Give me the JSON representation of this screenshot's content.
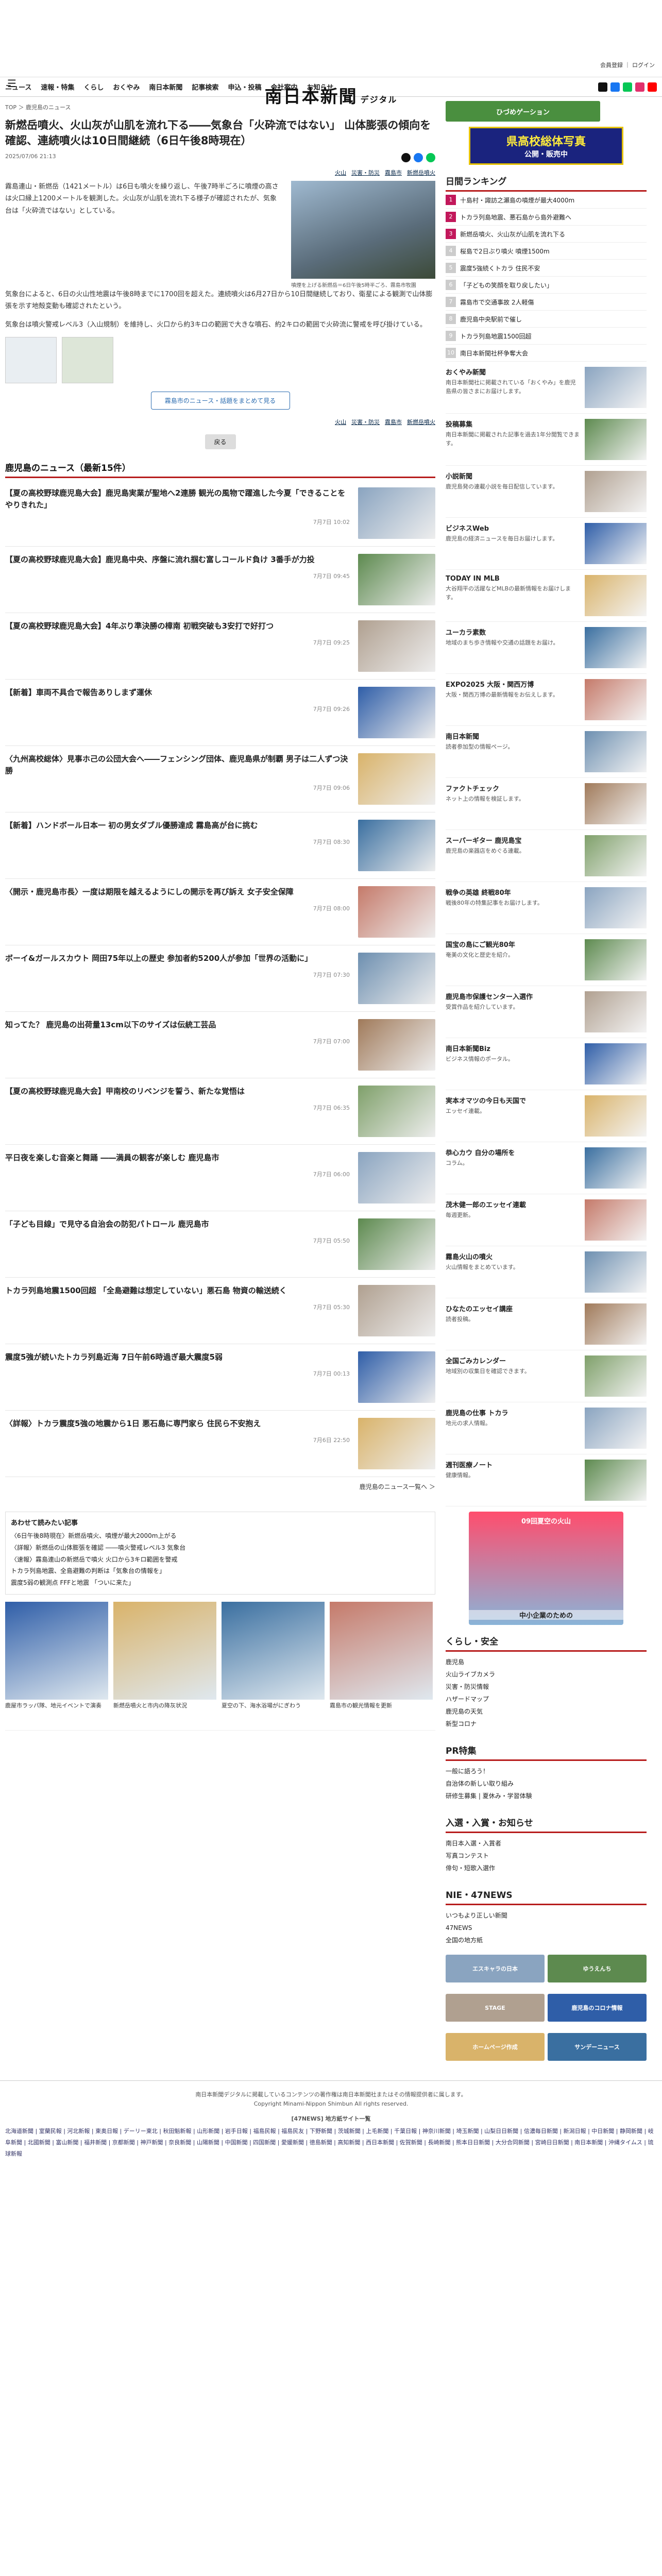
{
  "header": {
    "brand": "南日本新聞",
    "brand_sub": "デジタル",
    "top_right": "会員登録",
    "login": "ログイン"
  },
  "nav": [
    "ニュース",
    "速報・特集",
    "くらし",
    "おくやみ",
    "南日本新聞",
    "記事検索",
    "申込・投稿",
    "会社案内",
    "お知らせ"
  ],
  "crumb": "TOP ＞ 鹿児島のニュース",
  "article": {
    "title": "新燃岳噴火、火山灰が山肌を流れ下る――気象台「火砕流ではない」 山体膨張の傾向を確認、連続噴火は10日間継続（6日午後8時現在）",
    "date": "2025/07/06 21:13",
    "p1": "霧島連山・新燃岳（1421メートル）は6日も噴火を繰り返し、午後7時半ごろに噴煙の高さは火口縁上1200メートルを観測した。火山灰が山肌を流れ下る様子が確認されたが、気象台は「火砕流ではない」としている。",
    "p2": "気象台によると、6日の火山性地震は午後8時までに1700回を超えた。連続噴火は6月27日から10日間継続しており、衛星による観測で山体膨張を示す地殻変動も確認されたという。",
    "p3": "気象台は噴火警戒レベル3（入山規制）を維持し、火口から約3キロの範囲で大きな噴石、約2キロの範囲で火砕流に警戒を呼び掛けている。",
    "caption": "噴煙を上げる新燃岳＝6日午後5時半ごろ、霧島市牧園",
    "tags": [
      "火山",
      "災害・防災",
      "霧島市",
      "新燃岳噴火"
    ],
    "btn_more_news": "霧島市のニュース・話題をまとめて見る",
    "btn_back": "戻る"
  },
  "news_section": {
    "title": "鹿児島のニュース（最新15件）",
    "items": [
      {
        "t": "【夏の高校野球鹿児島大会】鹿児島実業が聖地へ2連勝 観光の風物で躍進した今夏「できることをやりきれた」",
        "d": "7月7日 10:02"
      },
      {
        "t": "【夏の高校野球鹿児島大会】鹿児島中央、序盤に流れ掴む富しコールド負け 3番手が力投",
        "d": "7月7日 09:45"
      },
      {
        "t": "【夏の高校野球鹿児島大会】4年ぶり準決勝の樟南 初戦突破も3安打で好打つ",
        "d": "7月7日 09:25"
      },
      {
        "t": "【新着】車両不具合で報告ありしまず運休",
        "d": "7月7日 09:26"
      },
      {
        "t": "〈九州高校総体〉見事ホ己の公団大会へ――フェンシング団体、鹿児島県が制覇 男子は二人ずつ決勝",
        "d": "7月7日 09:06"
      },
      {
        "t": "【新着】ハンドボール日本一 初の男女ダブル優勝達成 霧島高が台に挑む",
        "d": "7月7日 08:30"
      },
      {
        "t": "〈開示・鹿児島市長〉一度は期限を越えるようにしの開示を再び訴え 女子安全保障",
        "d": "7月7日 08:00"
      },
      {
        "t": "ボーイ&ガールスカウト 岡田75年以上の歴史 参加者約5200人が参加「世界の活動に」",
        "d": "7月7日 07:30"
      },
      {
        "t": "知ってた？ 鹿児島の出荷量13cm以下のサイズは伝統工芸品",
        "d": "7月7日 07:00"
      },
      {
        "t": "【夏の高校野球鹿児島大会】甲南校のリベンジを誓う、新たな覚悟は",
        "d": "7月7日 06:35"
      },
      {
        "t": "平日夜を楽しむ音楽と舞踊 ――満員の観客が楽しむ 鹿児島市",
        "d": "7月7日 06:00"
      },
      {
        "t": "「子ども目線」で見守る自治会の防犯パトロール 鹿児島市",
        "d": "7月7日 05:50"
      },
      {
        "t": "トカラ列島地震1500回超 「全島避難は想定していない」悪石島 物資の輸送続く",
        "d": "7月7日 05:30"
      },
      {
        "t": "震度5強が続いたトカラ列島近海 7日午前6時過ぎ最大震度5弱",
        "d": "7月7日 00:13"
      },
      {
        "t": "〈詳報〉トカラ震度5強の地震から1日 悪石島に専門家ら 住民ら不安抱え",
        "d": "7月6日 22:50"
      }
    ],
    "more": "鹿児島のニュース一覧へ ＞"
  },
  "bullets": {
    "title": "あわせて読みたい記事",
    "items": [
      "〈6日午後8時現在〉新燃岳噴火、噴煙が最大2000m上がる",
      "〈詳報〉新燃岳の山体膨張を確認 ――噴火警戒レベル3 気象台",
      "〈速報〉霧島連山の新燃岳で噴火 火口から3キロ範囲を警戒",
      "トカラ列島地震、全島避難の判断は「気象台の情報を」",
      "震度5弱の観測点 FFFと地震 「ついに来た」"
    ]
  },
  "cards": [
    {
      "t": "鹿屋市ラッパ隊、地元イベントで演奏"
    },
    {
      "t": "新燃岳噴火と市内の降灰状況"
    },
    {
      "t": "夏空の下、海水浴場がにぎわう"
    },
    {
      "t": "霧島市の観光情報を更新"
    }
  ],
  "sidebar": {
    "ad1": "ひづめゲーション",
    "ad2": "県高校総体写真",
    "ad2_sub": "公開・販売中",
    "ranking_title": "日間ランキング",
    "ranking": [
      "十島村・諏訪之瀬島の噴煙が最大4000m",
      "トカラ列島地震、悪石島から島外避難へ",
      "新燃岳噴火、火山灰が山肌を流れ下る",
      "桜島で2日ぶり噴火 噴煙1500m",
      "震度5強続くトカラ 住民不安",
      "「子どもの笑顔を取り戻したい」",
      "霧島市で交通事故 2人軽傷",
      "鹿児島中央駅前で催し",
      "トカラ列島地震1500回超",
      "南日本新聞社杯争奪大会"
    ],
    "items": [
      {
        "h": "おくやみ新聞",
        "p": "南日本新聞社に掲載されている「おくやみ」を鹿児島県の皆さまにお届けします。"
      },
      {
        "h": "投稿募集",
        "p": "南日本新聞に掲載された記事を過去1年分閲覧できます。"
      },
      {
        "h": "小説新聞",
        "p": "鹿児島発の連載小説を毎日配信しています。"
      },
      {
        "h": "ビジネスWeb",
        "p": "鹿児島の経済ニュースを毎日お届けします。"
      },
      {
        "h": "TODAY IN MLB",
        "p": "大谷翔平の活躍などMLBの最新情報をお届けします。"
      },
      {
        "h": "ユーカラ素数",
        "p": "地域のまち歩き情報や交通の話題をお届け。"
      },
      {
        "h": "EXPO2025 大阪・関西万博",
        "p": "大阪・関西万博の最新情報をお伝えします。"
      },
      {
        "h": "南日本新聞",
        "p": "読者参加型の情報ページ。"
      },
      {
        "h": "ファクトチェック",
        "p": "ネット上の情報を検証します。"
      },
      {
        "h": "スーパーギター 鹿児島宝",
        "p": "鹿児島の楽器店をめぐる連載。"
      },
      {
        "h": "戦争の英雄 終戦80年",
        "p": "戦後80年の特集記事をお届けします。"
      },
      {
        "h": "国宝の島にご観光80年",
        "p": "奄美の文化と歴史を紹介。"
      },
      {
        "h": "鹿児島市保護センター入選作",
        "p": "受賞作品を紹介しています。"
      },
      {
        "h": "南日本新聞Biz",
        "p": "ビジネス情報のポータル。"
      },
      {
        "h": "実本オマツの今日も天国で",
        "p": "エッセイ連載。"
      },
      {
        "h": "恭心カウ 自分の場所を",
        "p": "コラム。"
      },
      {
        "h": "茂木健一郎のエッセイ連載",
        "p": "毎週更新。"
      },
      {
        "h": "霧島火山の噴火",
        "p": "火山情報をまとめています。"
      },
      {
        "h": "ひなたのエッセイ講座",
        "p": "読者投稿。"
      },
      {
        "h": "全国ごみカレンダー",
        "p": "地域別の収集日を確認できます。"
      },
      {
        "h": "鹿児島の仕事 トカラ",
        "p": "地元の求人情報。"
      },
      {
        "h": "週刊医療ノート",
        "p": "健康情報。"
      }
    ],
    "ad3": "09回夏空の火山",
    "ad3_sub": "中小企業のための",
    "links_title": "くらし・安全",
    "links": [
      "鹿児島",
      "火山ライブカメラ",
      "災害・防災情報",
      "ハザードマップ",
      "鹿児島の天気",
      "新型コロナ"
    ],
    "pr_title": "PR特集",
    "pr": [
      "一般に語ろう！",
      "自治体の新しい取り組み",
      "研修生募集 | 夏休み・学習体験"
    ],
    "life_title": "入選・入賞・お知らせ",
    "life": [
      "南日本入選・入賞者",
      "写真コンテスト",
      "俳句・短歌入選作"
    ],
    "nie_title": "NIE・47NEWS",
    "nie": [
      "いつもより正しい新聞",
      "47NEWS",
      "全国の地方紙"
    ],
    "banners": [
      "エスキャラの日本",
      "ゆうえんち",
      "STAGE",
      "鹿児島のコロナ情報",
      "ホームページ作成",
      "サンデーニュース"
    ]
  },
  "footer": {
    "copy": "南日本新聞デジタルに掲載しているコンテンツの著作権は南日本新聞社またはその情報提供者に属します。",
    "company": "Copyright Minami-Nippon Shimbun All rights reserved.",
    "net": "[47NEWS] 地方紙サイト一覧",
    "regions": "北海道新聞 | 室蘭民報 | 河北新報 | 東奥日報 | デーリー東北 | 秋田魁新報 | 山形新聞 | 岩手日報 | 福島民報 | 福島民友 | 下野新聞 | 茨城新聞 | 上毛新聞 | 千葉日報 | 神奈川新聞 | 埼玉新聞 | 山梨日日新聞 | 信濃毎日新聞 | 新潟日報 | 中日新聞 | 静岡新聞 | 岐阜新聞 | 北國新聞 | 富山新聞 | 福井新聞 | 京都新聞 | 神戸新聞 | 奈良新聞 | 山陽新聞 | 中国新聞 | 四国新聞 | 愛媛新聞 | 徳島新聞 | 高知新聞 | 西日本新聞 | 佐賀新聞 | 長崎新聞 | 熊本日日新聞 | 大分合同新聞 | 宮崎日日新聞 | 南日本新聞 | 沖縄タイムス | 琉球新報"
  },
  "colors": {
    "accent": "#b71c1c",
    "rank_top": "#c2185b",
    "link": "#2b6cb0"
  }
}
